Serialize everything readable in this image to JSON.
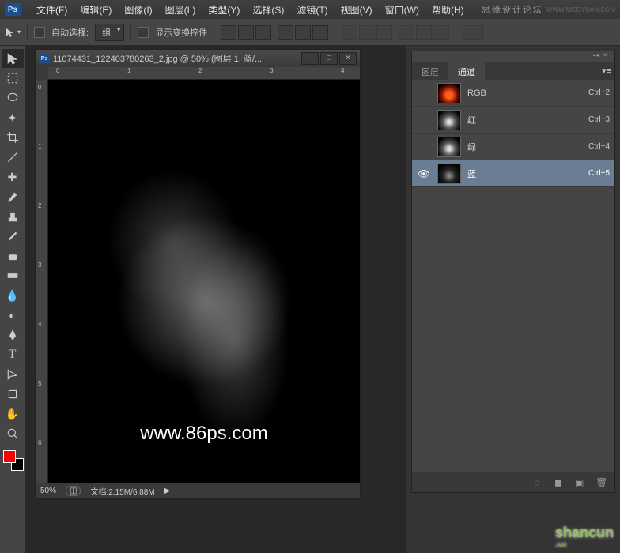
{
  "app": {
    "logo_text": "Ps"
  },
  "menu": [
    "文件(F)",
    "编辑(E)",
    "图像(I)",
    "图层(L)",
    "类型(Y)",
    "选择(S)",
    "滤镜(T)",
    "视图(V)",
    "窗口(W)",
    "帮助(H)"
  ],
  "header": {
    "forum": "思缘设计论坛",
    "url": "WWW.MISSYUAN.COM"
  },
  "options": {
    "auto_select_label": "自动选择:",
    "auto_select_value": "组",
    "show_transform_label": "显示变换控件"
  },
  "document": {
    "title": "11074431_122403780263_2.jpg @ 50% (图层 1, 蓝/...",
    "ruler_h": [
      "0",
      "1",
      "2",
      "3",
      "4"
    ],
    "ruler_v": [
      "0",
      "1",
      "2",
      "3",
      "4",
      "5",
      "6"
    ],
    "watermark": "www.86ps.com",
    "zoom": "50%",
    "doc_info_label": "文档:",
    "doc_info": "2.15M/6.88M"
  },
  "panels": {
    "tabs": {
      "layers": "图层",
      "channels": "通道"
    },
    "channels": [
      {
        "name": "RGB",
        "shortcut": "Ctrl+2",
        "thumb": "thumb-rgb",
        "visible": false,
        "selected": false
      },
      {
        "name": "红",
        "shortcut": "Ctrl+3",
        "thumb": "thumb-gray",
        "visible": false,
        "selected": false
      },
      {
        "name": "绿",
        "shortcut": "Ctrl+4",
        "thumb": "thumb-gray",
        "visible": false,
        "selected": false
      },
      {
        "name": "蓝",
        "shortcut": "Ctrl+5",
        "thumb": "thumb-blue",
        "visible": true,
        "selected": true
      }
    ]
  },
  "logo": {
    "main": "shancun",
    "sub": ".net"
  }
}
